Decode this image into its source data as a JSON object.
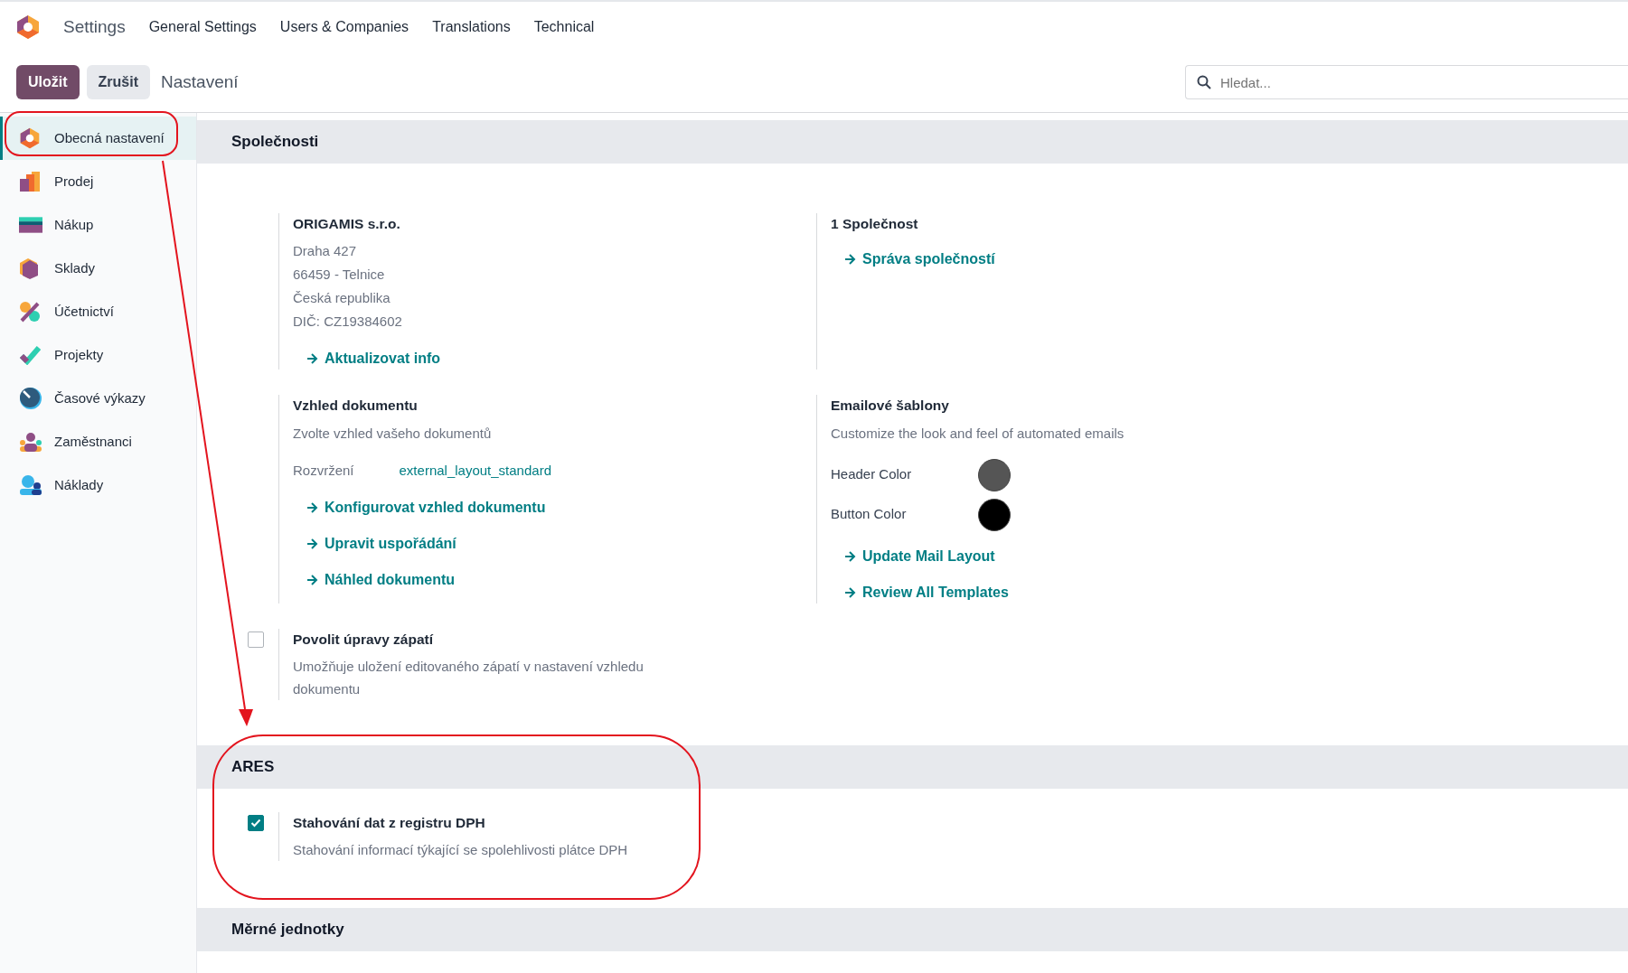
{
  "app": {
    "title": "Settings"
  },
  "menu": [
    {
      "label": "General Settings"
    },
    {
      "label": "Users & Companies"
    },
    {
      "label": "Translations"
    },
    {
      "label": "Technical"
    }
  ],
  "control_panel": {
    "buttons": [
      {
        "label": "Uložit",
        "kind": "primary"
      },
      {
        "label": "Zrušit",
        "kind": "secondary"
      }
    ],
    "breadcrumb": "Nastavení",
    "search": {
      "placeholder": "Hledat..."
    }
  },
  "sidebar": {
    "items": [
      {
        "label": "Obecná nastavení",
        "selected": true
      },
      {
        "label": "Prodej",
        "selected": false
      },
      {
        "label": "Nákup",
        "selected": false
      },
      {
        "label": "Sklady",
        "selected": false
      },
      {
        "label": "Účetnictví",
        "selected": false
      },
      {
        "label": "Projekty",
        "selected": false
      },
      {
        "label": "Časové výkazy",
        "selected": false
      },
      {
        "label": "Zaměstnanci",
        "selected": false
      },
      {
        "label": "Náklady",
        "selected": false
      }
    ]
  },
  "sections": [
    {
      "title": "Společnosti",
      "settings": [
        {
          "kind": "info",
          "title": "ORIGAMIS s.r.o.",
          "lines": [
            "Draha 427",
            "66459 - Telnice",
            "Česká republika",
            "DIČ:  CZ19384602"
          ],
          "links": [
            "Aktualizovat info"
          ]
        },
        {
          "kind": "info",
          "title": "1 Společnost",
          "links": [
            "Správa společností"
          ]
        },
        {
          "kind": "info",
          "title": "Vzhled dokumentu",
          "description": "Zvolte vzhled vašeho dokumentů",
          "field": {
            "label": "Rozvržení",
            "value": "external_layout_standard"
          },
          "links": [
            "Konfigurovat vzhled dokumentu",
            "Upravit uspořádání",
            "Náhled dokumentu"
          ]
        },
        {
          "kind": "info",
          "title": "Emailové šablony",
          "description": "Customize the look and feel of automated emails",
          "colors": [
            {
              "label": "Header Color",
              "color": "#555555"
            },
            {
              "label": "Button Color",
              "color": "#000000"
            }
          ],
          "links": [
            "Update Mail Layout",
            "Review All Templates"
          ]
        },
        {
          "kind": "checkbox",
          "title": "Povolit úpravy zápatí",
          "description": "Umožňuje uložení editovaného zápatí v nastavení vzhledu dokumentu",
          "checked": false
        }
      ]
    },
    {
      "title": "ARES",
      "settings": [
        {
          "kind": "checkbox",
          "title": "Stahování dat z registru DPH",
          "description": "Stahování informací týkající se spolehlivosti plátce DPH",
          "checked": true
        }
      ]
    },
    {
      "title": "Měrné jednotky"
    }
  ]
}
